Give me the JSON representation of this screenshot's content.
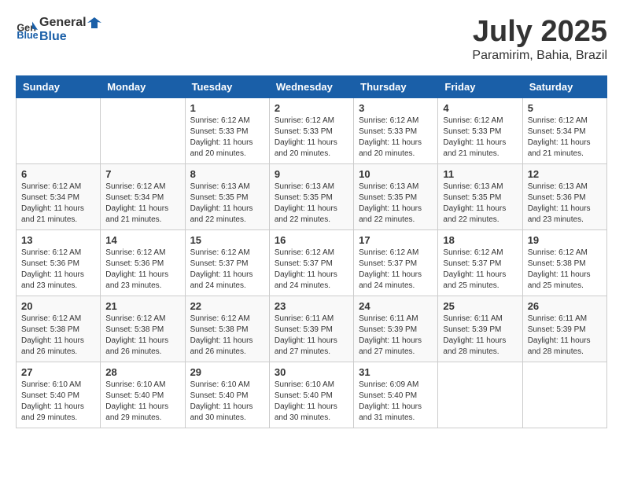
{
  "header": {
    "logo_general": "General",
    "logo_blue": "Blue",
    "month": "July 2025",
    "location": "Paramirim, Bahia, Brazil"
  },
  "weekdays": [
    "Sunday",
    "Monday",
    "Tuesday",
    "Wednesday",
    "Thursday",
    "Friday",
    "Saturday"
  ],
  "weeks": [
    [
      {
        "day": "",
        "info": ""
      },
      {
        "day": "",
        "info": ""
      },
      {
        "day": "1",
        "info": "Sunrise: 6:12 AM\nSunset: 5:33 PM\nDaylight: 11 hours and 20 minutes."
      },
      {
        "day": "2",
        "info": "Sunrise: 6:12 AM\nSunset: 5:33 PM\nDaylight: 11 hours and 20 minutes."
      },
      {
        "day": "3",
        "info": "Sunrise: 6:12 AM\nSunset: 5:33 PM\nDaylight: 11 hours and 20 minutes."
      },
      {
        "day": "4",
        "info": "Sunrise: 6:12 AM\nSunset: 5:33 PM\nDaylight: 11 hours and 21 minutes."
      },
      {
        "day": "5",
        "info": "Sunrise: 6:12 AM\nSunset: 5:34 PM\nDaylight: 11 hours and 21 minutes."
      }
    ],
    [
      {
        "day": "6",
        "info": "Sunrise: 6:12 AM\nSunset: 5:34 PM\nDaylight: 11 hours and 21 minutes."
      },
      {
        "day": "7",
        "info": "Sunrise: 6:12 AM\nSunset: 5:34 PM\nDaylight: 11 hours and 21 minutes."
      },
      {
        "day": "8",
        "info": "Sunrise: 6:13 AM\nSunset: 5:35 PM\nDaylight: 11 hours and 22 minutes."
      },
      {
        "day": "9",
        "info": "Sunrise: 6:13 AM\nSunset: 5:35 PM\nDaylight: 11 hours and 22 minutes."
      },
      {
        "day": "10",
        "info": "Sunrise: 6:13 AM\nSunset: 5:35 PM\nDaylight: 11 hours and 22 minutes."
      },
      {
        "day": "11",
        "info": "Sunrise: 6:13 AM\nSunset: 5:35 PM\nDaylight: 11 hours and 22 minutes."
      },
      {
        "day": "12",
        "info": "Sunrise: 6:13 AM\nSunset: 5:36 PM\nDaylight: 11 hours and 23 minutes."
      }
    ],
    [
      {
        "day": "13",
        "info": "Sunrise: 6:12 AM\nSunset: 5:36 PM\nDaylight: 11 hours and 23 minutes."
      },
      {
        "day": "14",
        "info": "Sunrise: 6:12 AM\nSunset: 5:36 PM\nDaylight: 11 hours and 23 minutes."
      },
      {
        "day": "15",
        "info": "Sunrise: 6:12 AM\nSunset: 5:37 PM\nDaylight: 11 hours and 24 minutes."
      },
      {
        "day": "16",
        "info": "Sunrise: 6:12 AM\nSunset: 5:37 PM\nDaylight: 11 hours and 24 minutes."
      },
      {
        "day": "17",
        "info": "Sunrise: 6:12 AM\nSunset: 5:37 PM\nDaylight: 11 hours and 24 minutes."
      },
      {
        "day": "18",
        "info": "Sunrise: 6:12 AM\nSunset: 5:37 PM\nDaylight: 11 hours and 25 minutes."
      },
      {
        "day": "19",
        "info": "Sunrise: 6:12 AM\nSunset: 5:38 PM\nDaylight: 11 hours and 25 minutes."
      }
    ],
    [
      {
        "day": "20",
        "info": "Sunrise: 6:12 AM\nSunset: 5:38 PM\nDaylight: 11 hours and 26 minutes."
      },
      {
        "day": "21",
        "info": "Sunrise: 6:12 AM\nSunset: 5:38 PM\nDaylight: 11 hours and 26 minutes."
      },
      {
        "day": "22",
        "info": "Sunrise: 6:12 AM\nSunset: 5:38 PM\nDaylight: 11 hours and 26 minutes."
      },
      {
        "day": "23",
        "info": "Sunrise: 6:11 AM\nSunset: 5:39 PM\nDaylight: 11 hours and 27 minutes."
      },
      {
        "day": "24",
        "info": "Sunrise: 6:11 AM\nSunset: 5:39 PM\nDaylight: 11 hours and 27 minutes."
      },
      {
        "day": "25",
        "info": "Sunrise: 6:11 AM\nSunset: 5:39 PM\nDaylight: 11 hours and 28 minutes."
      },
      {
        "day": "26",
        "info": "Sunrise: 6:11 AM\nSunset: 5:39 PM\nDaylight: 11 hours and 28 minutes."
      }
    ],
    [
      {
        "day": "27",
        "info": "Sunrise: 6:10 AM\nSunset: 5:40 PM\nDaylight: 11 hours and 29 minutes."
      },
      {
        "day": "28",
        "info": "Sunrise: 6:10 AM\nSunset: 5:40 PM\nDaylight: 11 hours and 29 minutes."
      },
      {
        "day": "29",
        "info": "Sunrise: 6:10 AM\nSunset: 5:40 PM\nDaylight: 11 hours and 30 minutes."
      },
      {
        "day": "30",
        "info": "Sunrise: 6:10 AM\nSunset: 5:40 PM\nDaylight: 11 hours and 30 minutes."
      },
      {
        "day": "31",
        "info": "Sunrise: 6:09 AM\nSunset: 5:40 PM\nDaylight: 11 hours and 31 minutes."
      },
      {
        "day": "",
        "info": ""
      },
      {
        "day": "",
        "info": ""
      }
    ]
  ]
}
